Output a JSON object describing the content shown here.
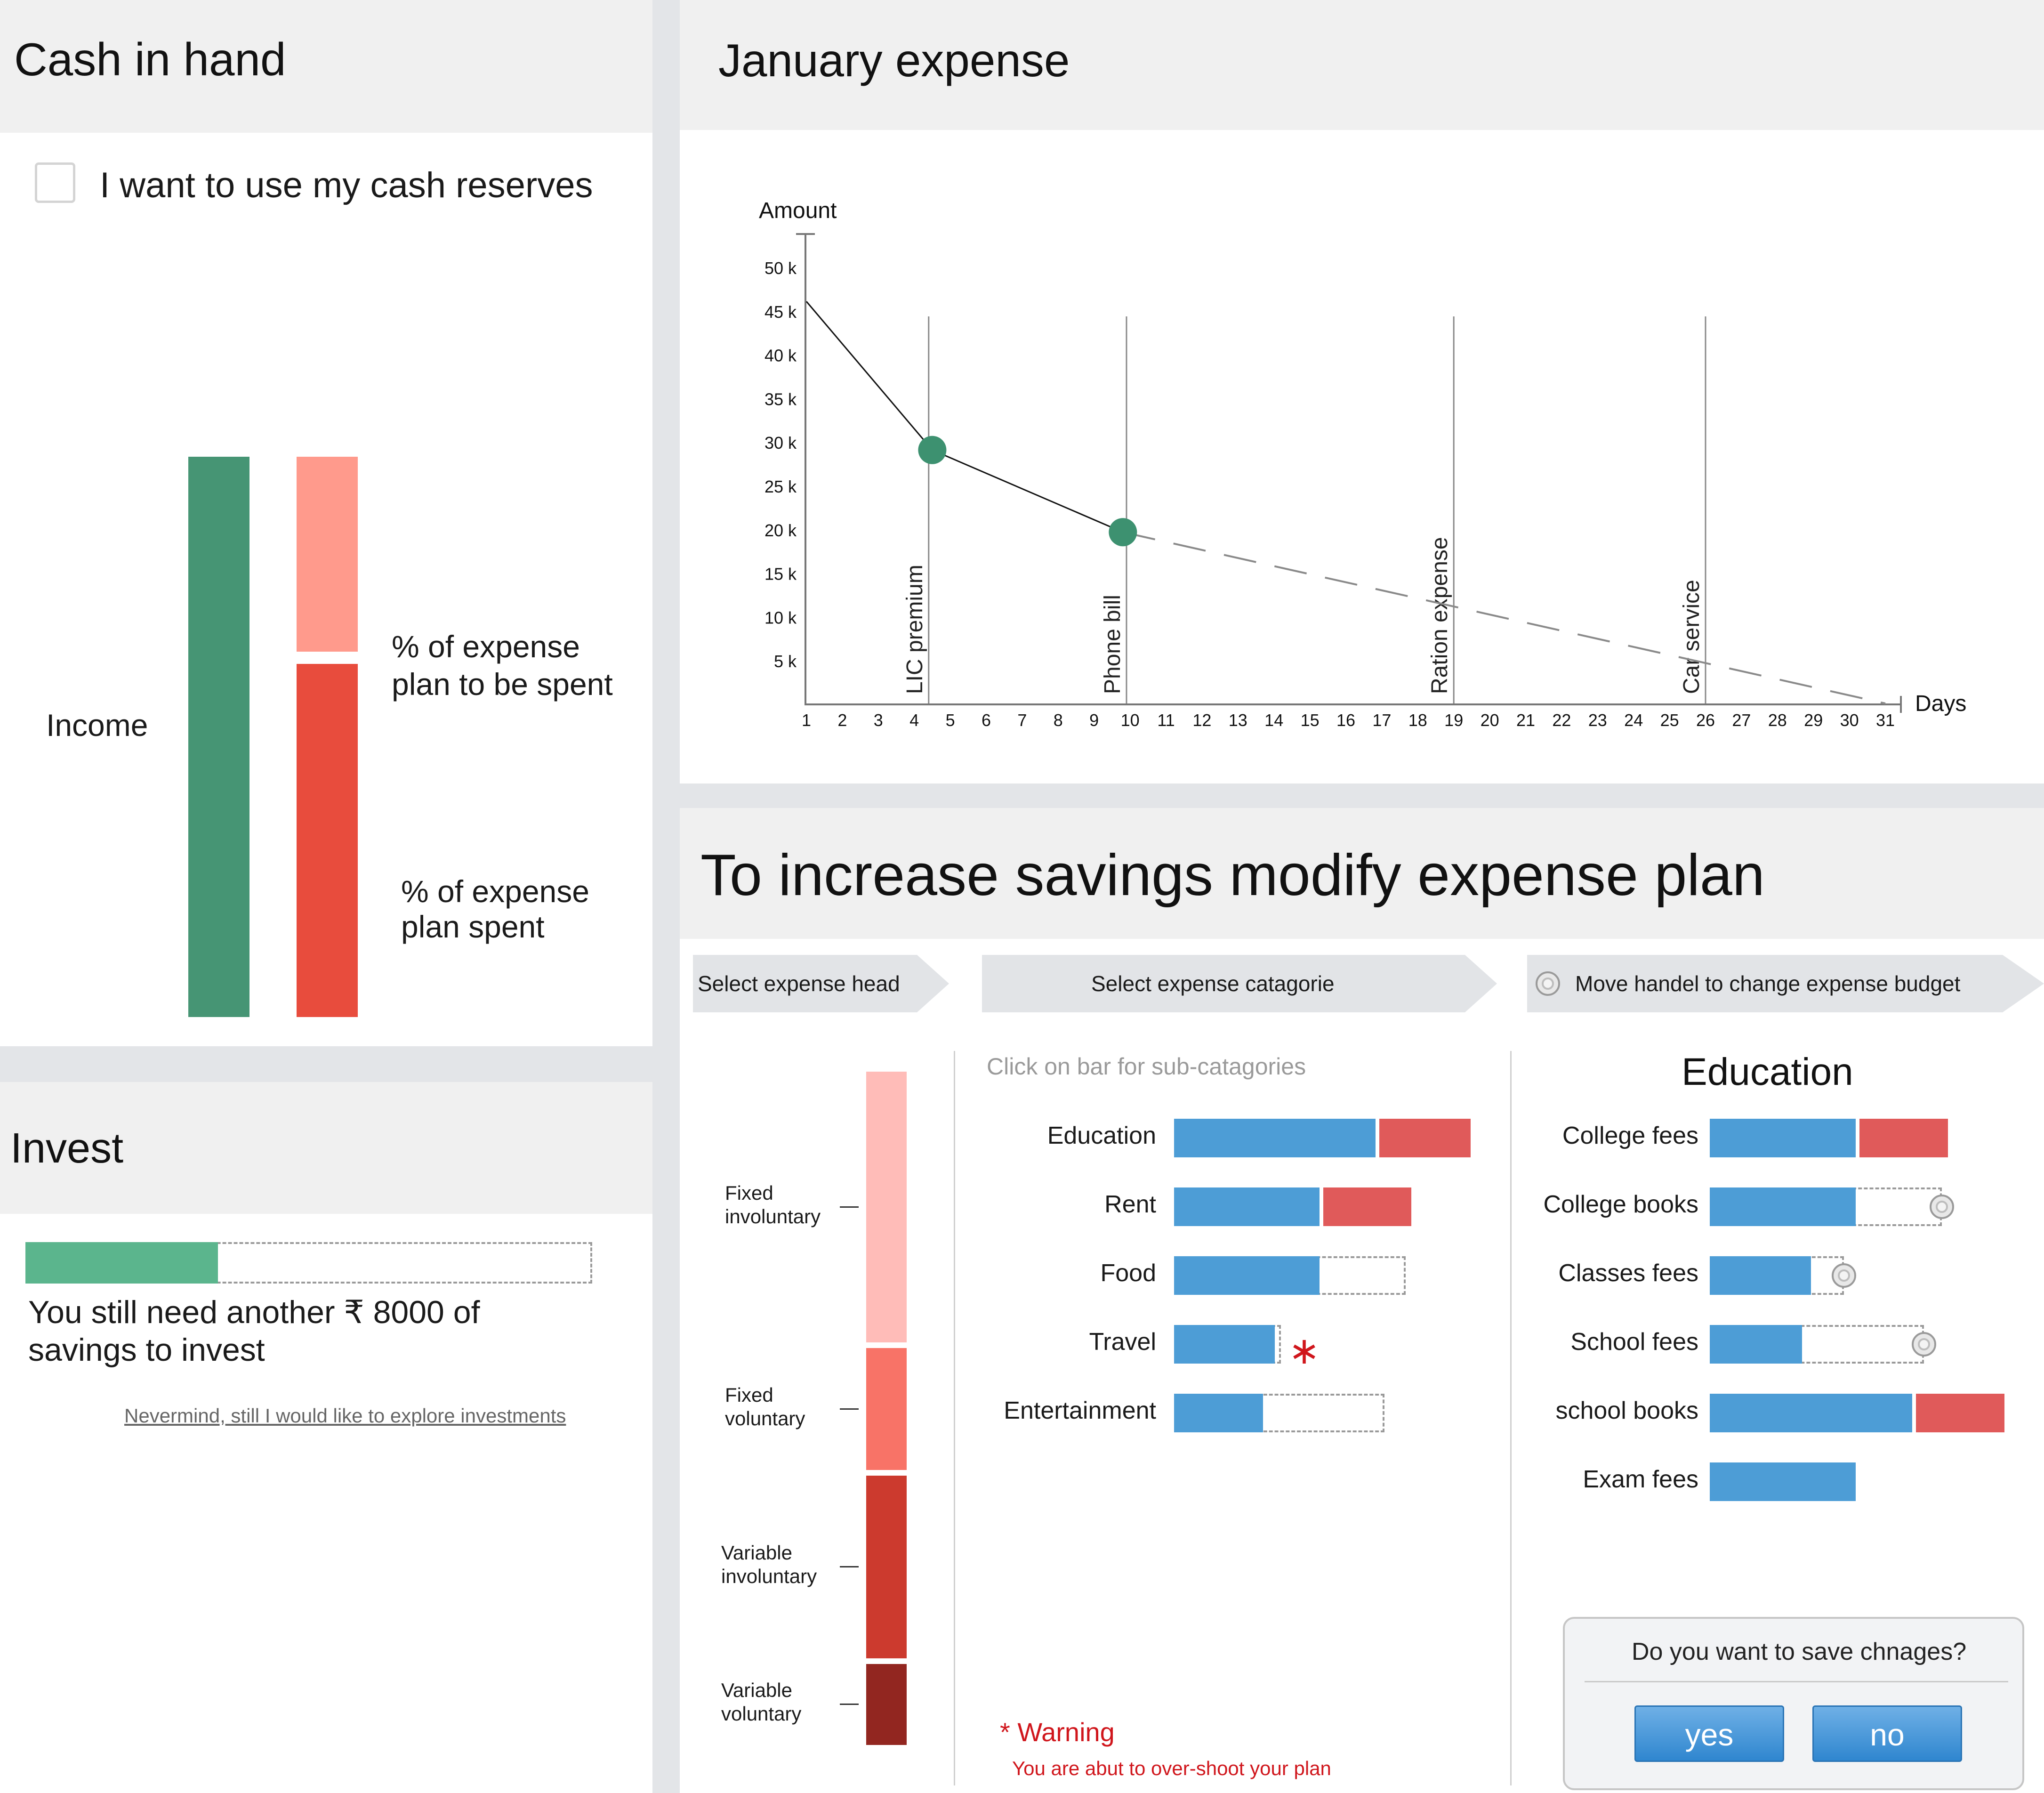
{
  "cash_in_hand": {
    "title": "Cash in hand",
    "checkbox_label": "I want to use my cash reserves",
    "checkbox_checked": false,
    "income_label": "Income",
    "plan_to_be_spent_label_line1": "% of expense",
    "plan_to_be_spent_label_line2": "plan to be spent",
    "plan_spent_label_line1": "% of expense",
    "plan_spent_label_line2": "plan spent",
    "colors": {
      "income": "#469574",
      "to_be_spent": "#ff9a8c",
      "spent": "#e84c3d"
    }
  },
  "invest": {
    "title": "Invest",
    "progress_fraction": 0.34,
    "message_line1": "You still need another ₹ 8000 of",
    "message_line2": "savings to invest",
    "explore_link": "Nevermind, still I would like to explore investments",
    "colors": {
      "progress": "#5bb58d"
    }
  },
  "january_expense": {
    "title": "January expense",
    "chart_data": {
      "type": "line",
      "ylabel": "Amount",
      "xlabel": "Days",
      "y_ticks": [
        "5 k",
        "10 k",
        "15 k",
        "20 k",
        "25 k",
        "30 k",
        "35 k",
        "40 k",
        "45 k",
        "50 k"
      ],
      "x_ticks": [
        "1",
        "2",
        "3",
        "4",
        "5",
        "6",
        "7",
        "8",
        "9",
        "10",
        "11",
        "12",
        "13",
        "14",
        "15",
        "16",
        "17",
        "18",
        "19",
        "20",
        "21",
        "22",
        "23",
        "24",
        "25",
        "26",
        "27",
        "28",
        "29",
        "30",
        "31"
      ],
      "ylim": [
        0,
        50000
      ],
      "xlim": [
        1,
        31
      ],
      "actual": [
        {
          "x": 1,
          "y": 46000
        },
        {
          "x": 4.5,
          "y": 29000
        },
        {
          "x": 9.8,
          "y": 19600
        }
      ],
      "projected": [
        {
          "x": 9.8,
          "y": 19600
        },
        {
          "x": 31,
          "y": 0
        }
      ],
      "events": [
        {
          "label": "LIC premium",
          "x": 4.4
        },
        {
          "label": "Phone bill",
          "x": 9.9
        },
        {
          "label": "Ration expense",
          "x": 19
        },
        {
          "label": "Car service",
          "x": 26
        }
      ],
      "colors": {
        "marker": "#3d9170",
        "actual_line": "#111111",
        "projected_line": "#8a8a8a"
      }
    }
  },
  "modify_plan": {
    "title": "To increase savings modify expense plan",
    "steps": [
      "Select expense head",
      "Select expense catagorie",
      "Move handel to change expense budget"
    ],
    "heads": [
      {
        "label_line1": "Fixed",
        "label_line2": "involuntary",
        "color": "#ffbcb8",
        "share": 0.4
      },
      {
        "label_line1": "Fixed",
        "label_line2": "voluntary",
        "color": "#f87367",
        "share": 0.18
      },
      {
        "label_line1": "Variable",
        "label_line2": "involuntary",
        "color": "#cc3a2e",
        "share": 0.27
      },
      {
        "label_line1": "Variable",
        "label_line2": "voluntary",
        "color": "#922620",
        "share": 0.12
      }
    ],
    "categories_hint": "Click on bar for sub-catagories",
    "categories": [
      {
        "label": "Education",
        "spent": 0.68,
        "remaining": 0.32,
        "over": true
      },
      {
        "label": "Rent",
        "spent": 0.49,
        "remaining": 0.31,
        "over": true
      },
      {
        "label": "Food",
        "spent": 0.49,
        "remaining": 0.29,
        "over": false
      },
      {
        "label": "Travel",
        "spent": 0.34,
        "remaining": 0.02,
        "over": false,
        "warning": true
      },
      {
        "label": "Entertainment",
        "spent": 0.3,
        "remaining": 0.41,
        "over": false
      }
    ],
    "warning_title": "* Warning",
    "warning_text": "You are abut to over-shoot your plan",
    "subcategory_title": "Education",
    "subcategories": [
      {
        "label": "College fees",
        "spent": 0.49,
        "remaining": 0.31,
        "over": true,
        "handle": false
      },
      {
        "label": "College books",
        "spent": 0.49,
        "remaining": 0.29,
        "over": false,
        "handle": true
      },
      {
        "label": "Classes fees",
        "spent": 0.34,
        "remaining": 0.11,
        "over": false,
        "handle": true
      },
      {
        "label": "School fees",
        "spent": 0.31,
        "remaining": 0.41,
        "over": false,
        "handle": true
      },
      {
        "label": "school books",
        "spent": 0.68,
        "remaining": 0.31,
        "over": true,
        "handle": false
      },
      {
        "label": "Exam fees",
        "spent": 0.49,
        "remaining": 0,
        "over": false,
        "handle": false
      }
    ],
    "save_dialog": {
      "question": "Do you want to save chnages?",
      "yes_label": "yes",
      "no_label": "no"
    },
    "colors": {
      "spent": "#4d9dd6",
      "over": "#e05a5a",
      "warning": "#d0161c"
    }
  }
}
